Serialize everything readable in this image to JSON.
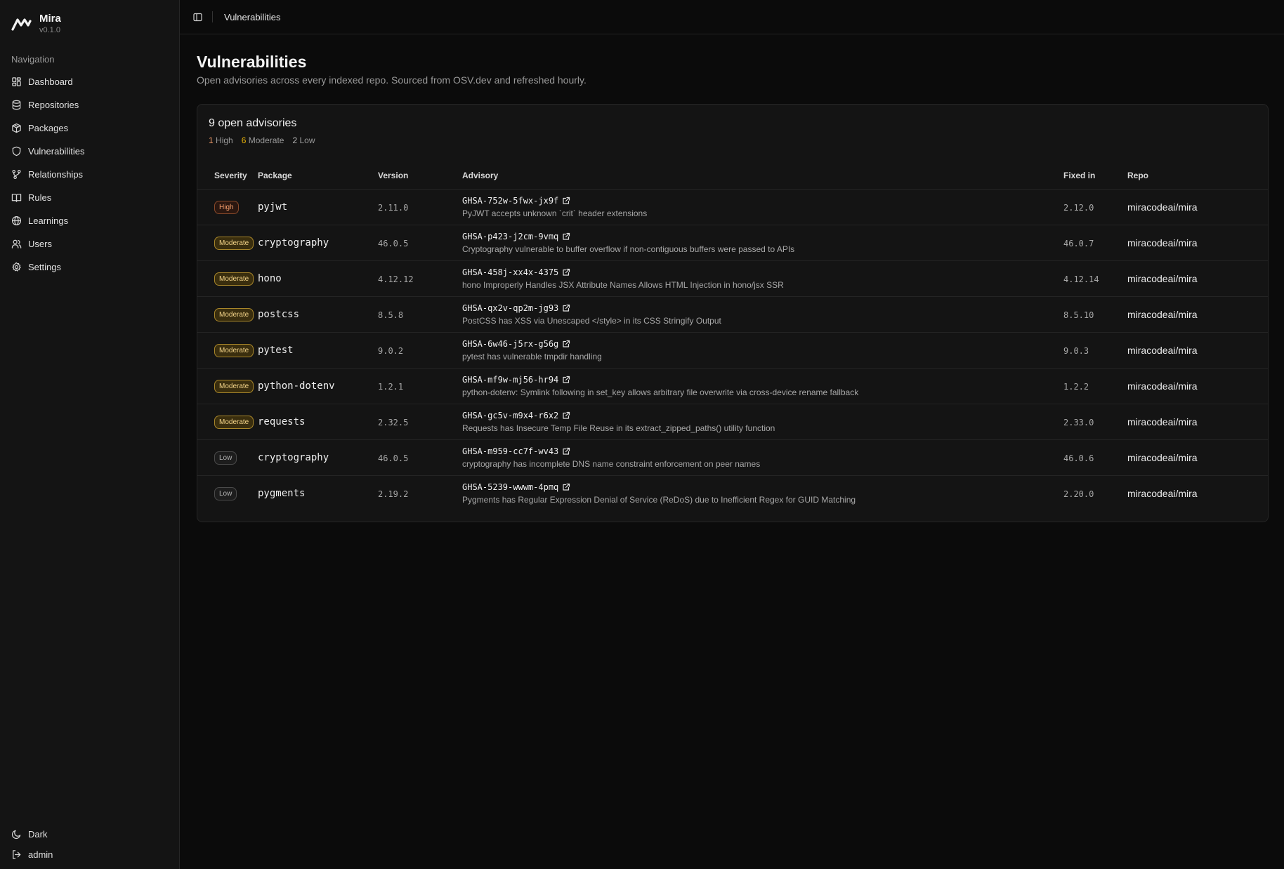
{
  "brand": {
    "name": "Mira",
    "version": "v0.1.0"
  },
  "sidebar": {
    "heading": "Navigation",
    "items": [
      {
        "label": "Dashboard",
        "icon": "dashboard-icon"
      },
      {
        "label": "Repositories",
        "icon": "database-icon"
      },
      {
        "label": "Packages",
        "icon": "package-icon"
      },
      {
        "label": "Vulnerabilities",
        "icon": "shield-icon"
      },
      {
        "label": "Relationships",
        "icon": "git-branch-icon"
      },
      {
        "label": "Rules",
        "icon": "book-icon"
      },
      {
        "label": "Learnings",
        "icon": "globe-icon"
      },
      {
        "label": "Users",
        "icon": "users-icon"
      },
      {
        "label": "Settings",
        "icon": "gear-icon"
      }
    ],
    "footer": {
      "theme_label": "Dark",
      "user_label": "admin"
    }
  },
  "topbar": {
    "title": "Vulnerabilities"
  },
  "page": {
    "title": "Vulnerabilities",
    "subtitle": "Open advisories across every indexed repo. Sourced from OSV.dev and refreshed hourly."
  },
  "summary": {
    "title": "9 open advisories",
    "high_count": "1",
    "high_label": "High",
    "moderate_count": "6",
    "moderate_label": "Moderate",
    "low_count": "2",
    "low_label": "Low"
  },
  "table": {
    "headers": {
      "severity": "Severity",
      "package": "Package",
      "version": "Version",
      "advisory": "Advisory",
      "fixed_in": "Fixed in",
      "repo": "Repo"
    },
    "rows": [
      {
        "severity": "High",
        "level": "high",
        "package": "pyjwt",
        "version": "2.11.0",
        "advisory_id": "GHSA-752w-5fwx-jx9f",
        "advisory_desc": "PyJWT accepts unknown `crit` header extensions",
        "fixed_in": "2.12.0",
        "repo": "miracodeai/mira"
      },
      {
        "severity": "Moderate",
        "level": "moderate",
        "package": "cryptography",
        "version": "46.0.5",
        "advisory_id": "GHSA-p423-j2cm-9vmq",
        "advisory_desc": "Cryptography vulnerable to buffer overflow if non-contiguous buffers were passed to APIs",
        "fixed_in": "46.0.7",
        "repo": "miracodeai/mira"
      },
      {
        "severity": "Moderate",
        "level": "moderate",
        "package": "hono",
        "version": "4.12.12",
        "advisory_id": "GHSA-458j-xx4x-4375",
        "advisory_desc": "hono Improperly Handles JSX Attribute Names Allows HTML Injection in hono/jsx SSR",
        "fixed_in": "4.12.14",
        "repo": "miracodeai/mira"
      },
      {
        "severity": "Moderate",
        "level": "moderate",
        "package": "postcss",
        "version": "8.5.8",
        "advisory_id": "GHSA-qx2v-qp2m-jg93",
        "advisory_desc": "PostCSS has XSS via Unescaped </style> in its CSS Stringify Output",
        "fixed_in": "8.5.10",
        "repo": "miracodeai/mira"
      },
      {
        "severity": "Moderate",
        "level": "moderate",
        "package": "pytest",
        "version": "9.0.2",
        "advisory_id": "GHSA-6w46-j5rx-g56g",
        "advisory_desc": "pytest has vulnerable tmpdir handling",
        "fixed_in": "9.0.3",
        "repo": "miracodeai/mira"
      },
      {
        "severity": "Moderate",
        "level": "moderate",
        "package": "python-dotenv",
        "version": "1.2.1",
        "advisory_id": "GHSA-mf9w-mj56-hr94",
        "advisory_desc": "python-dotenv: Symlink following in set_key allows arbitrary file overwrite via cross-device rename fallback",
        "fixed_in": "1.2.2",
        "repo": "miracodeai/mira"
      },
      {
        "severity": "Moderate",
        "level": "moderate",
        "package": "requests",
        "version": "2.32.5",
        "advisory_id": "GHSA-gc5v-m9x4-r6x2",
        "advisory_desc": "Requests has Insecure Temp File Reuse in its extract_zipped_paths() utility function",
        "fixed_in": "2.33.0",
        "repo": "miracodeai/mira"
      },
      {
        "severity": "Low",
        "level": "low",
        "package": "cryptography",
        "version": "46.0.5",
        "advisory_id": "GHSA-m959-cc7f-wv43",
        "advisory_desc": "cryptography has incomplete DNS name constraint enforcement on peer names",
        "fixed_in": "46.0.6",
        "repo": "miracodeai/mira"
      },
      {
        "severity": "Low",
        "level": "low",
        "package": "pygments",
        "version": "2.19.2",
        "advisory_id": "GHSA-5239-wwwm-4pmq",
        "advisory_desc": "Pygments has Regular Expression Denial of Service (ReDoS) due to Inefficient Regex for GUID Matching",
        "fixed_in": "2.20.0",
        "repo": "miracodeai/mira"
      }
    ]
  }
}
